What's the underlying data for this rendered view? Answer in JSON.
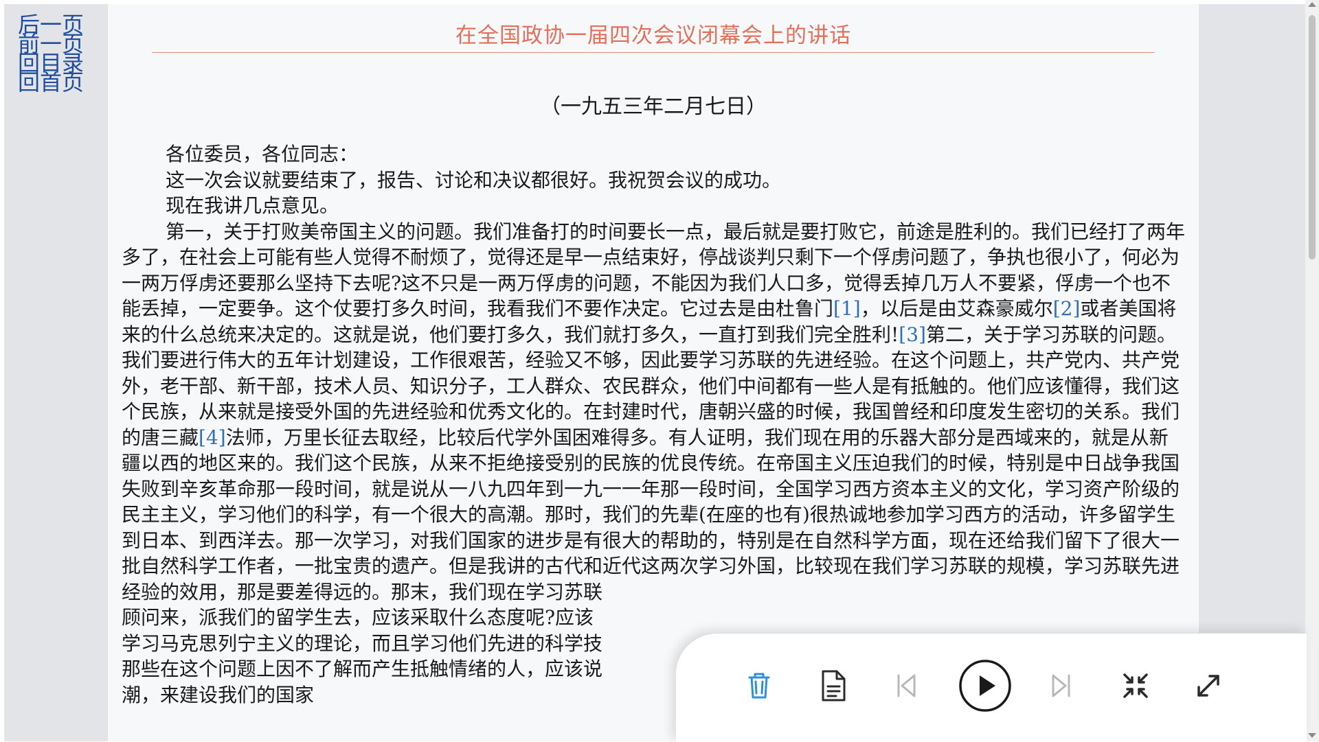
{
  "nav": {
    "next_page": "后一页",
    "prev_page": "前一页",
    "back_to_toc": "回目录",
    "back_to_home": "回首页"
  },
  "article": {
    "title": "在全国政协一届四次会议闭幕会上的讲话",
    "date": "（一九五三年二月七日）",
    "p1": "各位委员，各位同志：",
    "p2": "这一次会议就要结束了，报告、讨论和决议都很好。我祝贺会议的成功。",
    "p3": "现在我讲几点意见。",
    "p4_a": "第一，关于打败美帝国主义的问题。我们准备打的时间要长一点，最后就是要打败它，前途是胜利的。我们已经打了两年多了，在社会上可能有些人觉得不耐烦了，觉得还是早一点结束好，停战谈判只剩下一个俘虏问题了，争执也很小了，何必为一两万俘虏还要那么坚持下去呢?这不只是一两万俘虏的问题，不能因为我们人口多，觉得丢掉几万人不要紧，俘虏一个也不能丢掉，一定要争。这个仗要打多久时间，我看我们不要作决定。它过去是由杜鲁门",
    "fn1": "[1]",
    "p4_b": "，以后是由艾森豪威尔",
    "fn2": "[2]",
    "p4_c": "或者美国将来的什么总统来决定的。这就是说，他们要打多久，我们就打多久，一直打到我们完全胜利!",
    "fn3": "[3]",
    "p4_d": "第二，关于学习苏联的问题。我们要进行伟大的五年计划建设，工作很艰苦，经验又不够，因此要学习苏联的先进经验。在这个问题上，共产党内、共产党外，老干部、新干部，技术人员、知识分子，工人群众、农民群众，他们中间都有一些人是有抵触的。他们应该懂得，我们这个民族，从来就是接受外国的先进经验和优秀文化的。在封建时代，唐朝兴盛的时候，我国曾经和印度发生密切的关系。我们的唐三藏",
    "fn4": "[4]",
    "p4_e": "法师，万里长征去取经，比较后代学外国困难得多。有人证明，我们现在用的乐器大部分是西域来的，就是从新疆以西的地区来的。我们这个民族，从来不拒绝接受别的民族的优良传统。在帝国主义压迫我们的时候，特别是中日战争我国失败到辛亥革命那一段时间，就是说从一八九四年到一九一一年那一段时间，全国学习西方资本主义的文化，学习资产阶级的民主主义，学习他们的科学，有一个很大的高潮。那时，我们的先辈(在座的也有)很热诚地参加学习西方的活动，许多留学生到日本、到西洋去。那一次学习，对我们国家的进步是有很大的帮助的，特别是在自然科学方面，现在还给我们留下了很大一批自然科学工作者，一批宝贵的遗产。但是我讲的古代和近代这两次学习外国，比较现在我们学习苏联的规模，学习苏联先进经验的效用，那是要差得远的。那末，我们现在学习苏联",
    "p4_f": "顾问来，派我们的留学生去，应该采取什么态度呢?应该",
    "p4_g": "学习马克思列宁主义的理论，而且学习他们先进的科学技",
    "p4_h": "那些在这个问题上因不了解而产生抵触情绪的人，应该说",
    "p4_i": "潮，来建设我们的国家"
  },
  "player": {
    "icons": [
      "trash-icon",
      "document-icon",
      "skip-previous-icon",
      "play-icon",
      "skip-next-icon",
      "fit-screen-icon",
      "expand-icon"
    ],
    "accent_color": "#2f8fd8",
    "icon_color": "#2b2b2b",
    "disabled_color": "#b8b8b8"
  },
  "colors": {
    "title": "#e2705a",
    "nav_link": "#1f4e9e",
    "footnote": "#2f6fb5",
    "side_panel": "#e2e4e7",
    "content_bg": "#f6f8fa"
  }
}
